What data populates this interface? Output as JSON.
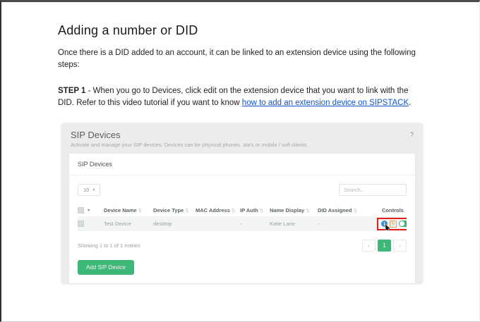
{
  "doc": {
    "title": "Adding a number or DID",
    "intro": "Once there is a DID added to an account, it can be linked to an extension device using the following steps:",
    "step1_bold": "STEP 1",
    "step1_text": " - When you go to Devices, click edit on the extension device that you want to link with the DID. Refer to this video tutorial if you want to know ",
    "step1_link": "how to add an extension device on SIPSTACK",
    "step1_end": "."
  },
  "panel": {
    "title": "SIP Devices",
    "subtitle": "Activate and manage your SIP devices. Devices can be physical phones, ata's or mobile / soft clients.",
    "help_icon": "?",
    "card_title": "SIP Devices",
    "page_size": "10",
    "search_placeholder": "Search..",
    "table": {
      "headers": [
        "Device Name",
        "Device Type",
        "MAC Address",
        "IP Auth",
        "Name Display",
        "DID Assigned",
        "Controls"
      ],
      "row": {
        "device_name": "Test Device",
        "device_type": "desktop",
        "mac_address": "",
        "ip_auth": "-",
        "name_display": "Katie Lane",
        "did_assigned": "-"
      }
    },
    "footer": {
      "showing_text": "Showing 1 to 1 of 1 entries",
      "prev": "‹",
      "page": "1",
      "next": "›"
    },
    "add_button": "Add SIP Device"
  },
  "icons": {
    "caret": "▾",
    "sort": "⇅",
    "info": "i",
    "pencil": "✎"
  },
  "colors": {
    "accent_green": "#3cb878",
    "highlight_red": "#e01e1e",
    "link_blue": "#1155cc",
    "info_blue": "#3e8fd0",
    "edit_orange": "#e2a14f",
    "status_dot": "#5f6568"
  }
}
